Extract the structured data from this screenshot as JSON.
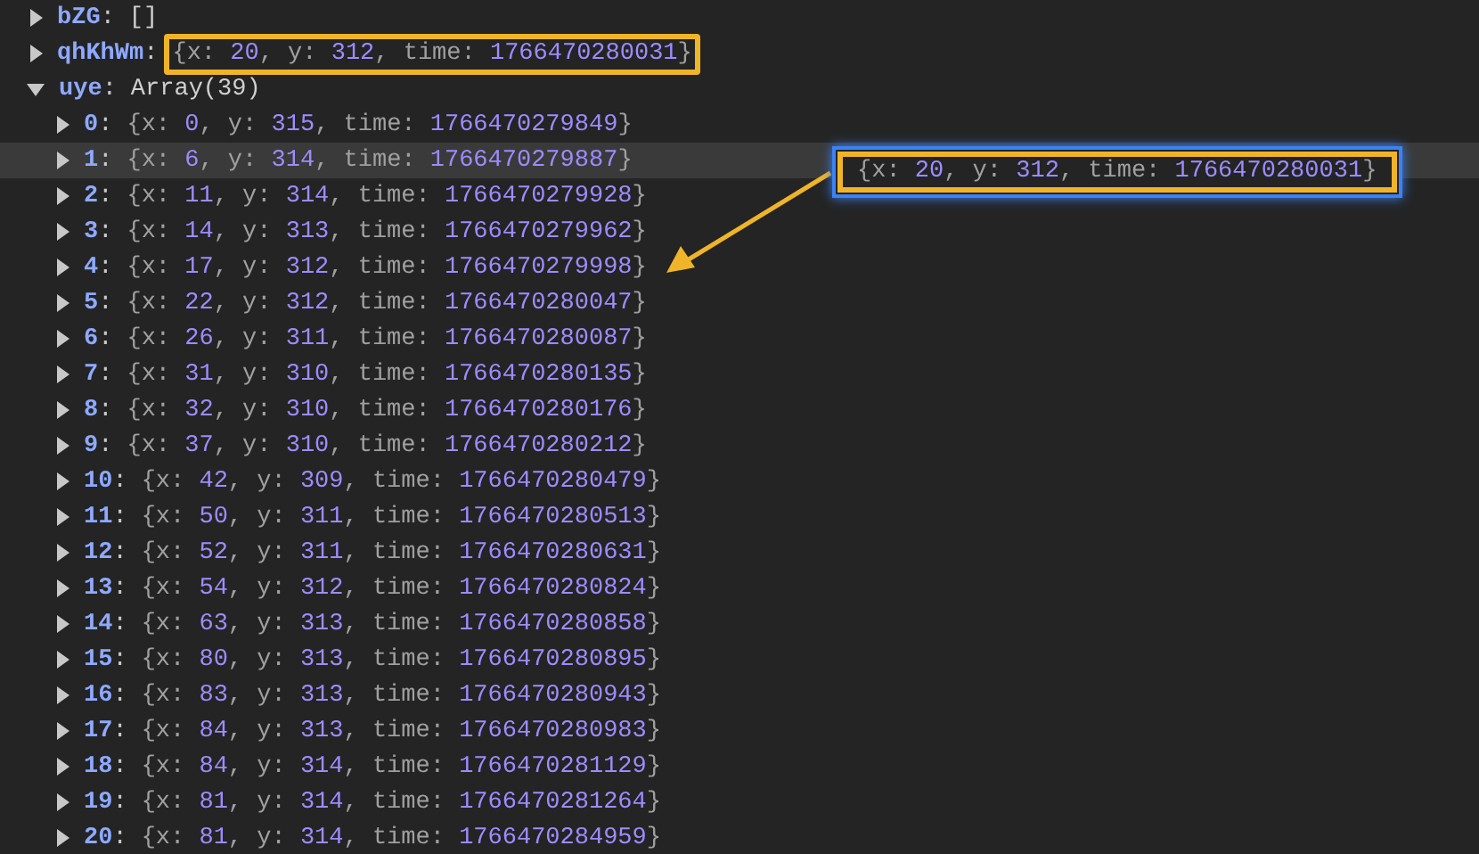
{
  "properties": [
    {
      "key": "bZG",
      "sep": ":",
      "kind": "empty-array",
      "value": "[]",
      "expanded": false,
      "boxed": false
    },
    {
      "key": "qhKhWm",
      "sep": ":",
      "kind": "point",
      "parts": [
        "{x: ",
        "20",
        ", y: ",
        "312",
        ", time: ",
        "1766470280031",
        "}"
      ],
      "expanded": false,
      "boxed": true
    },
    {
      "key": "uye",
      "sep": ":",
      "kind": "array",
      "value": "Array(39)",
      "expanded": true,
      "boxed": false,
      "children": [
        {
          "key": "0",
          "sep": ":",
          "parts": [
            "{x: ",
            "0",
            ", y: ",
            "315",
            ", time: ",
            "1766470279849",
            "}"
          ],
          "selected": false
        },
        {
          "key": "1",
          "sep": ":",
          "parts": [
            "{x: ",
            "6",
            ", y: ",
            "314",
            ", time: ",
            "1766470279887",
            "}"
          ],
          "selected": true
        },
        {
          "key": "2",
          "sep": ":",
          "parts": [
            "{x: ",
            "11",
            ", y: ",
            "314",
            ", time: ",
            "1766470279928",
            "}"
          ],
          "selected": false
        },
        {
          "key": "3",
          "sep": ":",
          "parts": [
            "{x: ",
            "14",
            ", y: ",
            "313",
            ", time: ",
            "1766470279962",
            "}"
          ],
          "selected": false
        },
        {
          "key": "4",
          "sep": ":",
          "parts": [
            "{x: ",
            "17",
            ", y: ",
            "312",
            ", time: ",
            "1766470279998",
            "}"
          ],
          "selected": false
        },
        {
          "key": "5",
          "sep": ":",
          "parts": [
            "{x: ",
            "22",
            ", y: ",
            "312",
            ", time: ",
            "1766470280047",
            "}"
          ],
          "selected": false
        },
        {
          "key": "6",
          "sep": ":",
          "parts": [
            "{x: ",
            "26",
            ", y: ",
            "311",
            ", time: ",
            "1766470280087",
            "}"
          ],
          "selected": false
        },
        {
          "key": "7",
          "sep": ":",
          "parts": [
            "{x: ",
            "31",
            ", y: ",
            "310",
            ", time: ",
            "1766470280135",
            "}"
          ],
          "selected": false
        },
        {
          "key": "8",
          "sep": ":",
          "parts": [
            "{x: ",
            "32",
            ", y: ",
            "310",
            ", time: ",
            "1766470280176",
            "}"
          ],
          "selected": false
        },
        {
          "key": "9",
          "sep": ":",
          "parts": [
            "{x: ",
            "37",
            ", y: ",
            "310",
            ", time: ",
            "1766470280212",
            "}"
          ],
          "selected": false
        },
        {
          "key": "10",
          "sep": ":",
          "parts": [
            "{x: ",
            "42",
            ", y: ",
            "309",
            ", time: ",
            "1766470280479",
            "}"
          ],
          "selected": false
        },
        {
          "key": "11",
          "sep": ":",
          "parts": [
            "{x: ",
            "50",
            ", y: ",
            "311",
            ", time: ",
            "1766470280513",
            "}"
          ],
          "selected": false
        },
        {
          "key": "12",
          "sep": ":",
          "parts": [
            "{x: ",
            "52",
            ", y: ",
            "311",
            ", time: ",
            "1766470280631",
            "}"
          ],
          "selected": false
        },
        {
          "key": "13",
          "sep": ":",
          "parts": [
            "{x: ",
            "54",
            ", y: ",
            "312",
            ", time: ",
            "1766470280824",
            "}"
          ],
          "selected": false
        },
        {
          "key": "14",
          "sep": ":",
          "parts": [
            "{x: ",
            "63",
            ", y: ",
            "313",
            ", time: ",
            "1766470280858",
            "}"
          ],
          "selected": false
        },
        {
          "key": "15",
          "sep": ":",
          "parts": [
            "{x: ",
            "80",
            ", y: ",
            "313",
            ", time: ",
            "1766470280895",
            "}"
          ],
          "selected": false
        },
        {
          "key": "16",
          "sep": ":",
          "parts": [
            "{x: ",
            "83",
            ", y: ",
            "313",
            ", time: ",
            "1766470280943",
            "}"
          ],
          "selected": false
        },
        {
          "key": "17",
          "sep": ":",
          "parts": [
            "{x: ",
            "84",
            ", y: ",
            "313",
            ", time: ",
            "1766470280983",
            "}"
          ],
          "selected": false
        },
        {
          "key": "18",
          "sep": ":",
          "parts": [
            "{x: ",
            "84",
            ", y: ",
            "314",
            ", time: ",
            "1766470281129",
            "}"
          ],
          "selected": false
        },
        {
          "key": "19",
          "sep": ":",
          "parts": [
            "{x: ",
            "81",
            ", y: ",
            "314",
            ", time: ",
            "1766470281264",
            "}"
          ],
          "selected": false
        },
        {
          "key": "20",
          "sep": ":",
          "parts": [
            "{x: ",
            "81",
            ", y: ",
            "314",
            ", time: ",
            "1766470284959",
            "}"
          ],
          "selected": false
        }
      ]
    }
  ],
  "callout": {
    "parts": [
      "{x: ",
      "20",
      ", y: ",
      "312",
      ", time: ",
      "1766470280031",
      "}"
    ]
  }
}
